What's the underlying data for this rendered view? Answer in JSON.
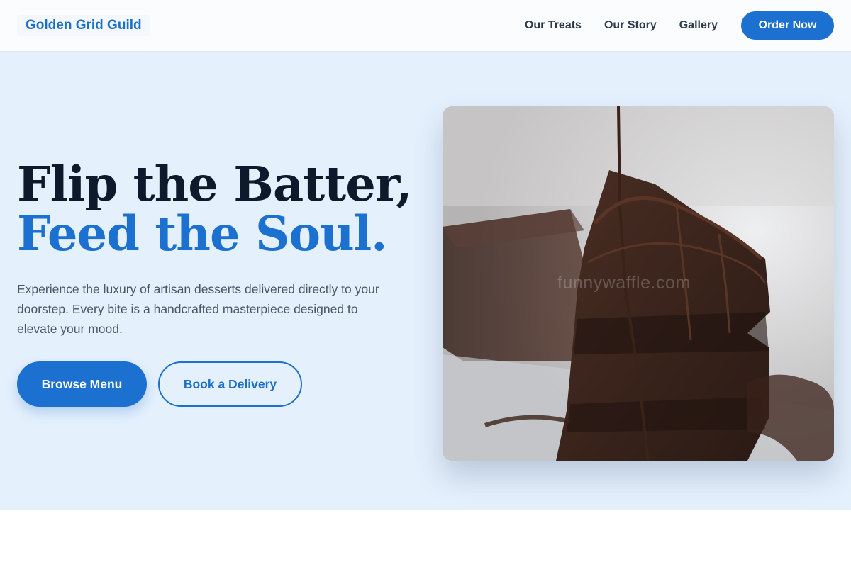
{
  "nav": {
    "logo": "Golden Grid Guild",
    "links": [
      "Our Treats",
      "Our Story",
      "Gallery"
    ],
    "cta": "Order Now"
  },
  "hero": {
    "headline_line1": "Flip the Batter,",
    "headline_line2": "Feed the Soul.",
    "description": "Experience the luxury of artisan desserts delivered directly to your doorstep. Every bite is a handcrafted masterpiece designed to elevate your mood.",
    "primary_button": "Browse Menu",
    "secondary_button": "Book a Delivery",
    "image_watermark": "funnywaffle.com"
  },
  "colors": {
    "accent": "#1c70d0",
    "hero_background": "#e4f0fc",
    "headline_dark": "#0e1a2b"
  }
}
